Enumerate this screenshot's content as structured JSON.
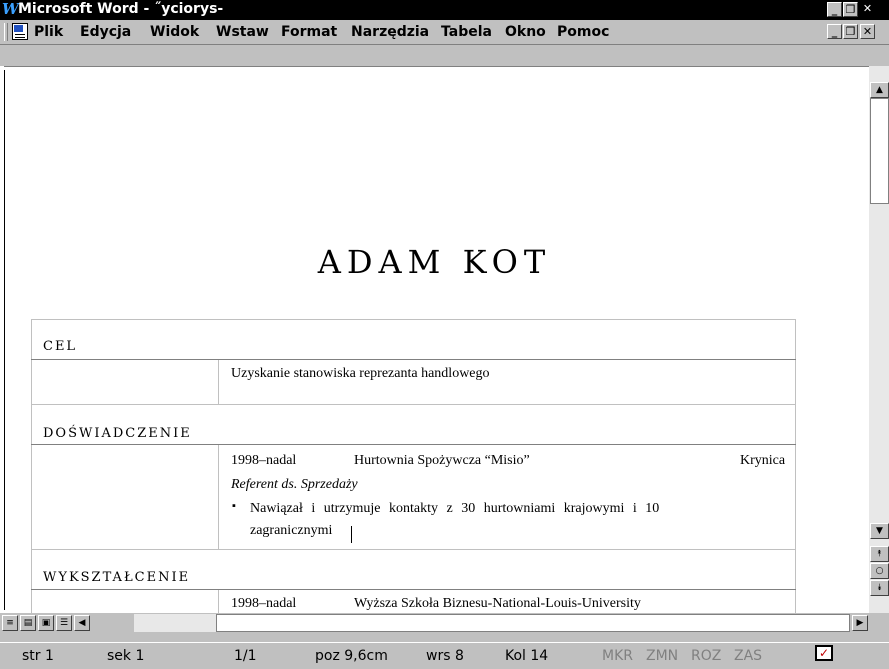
{
  "window": {
    "title": "Microsoft Word - ˝yciorys-",
    "app_icon": "word-w-icon"
  },
  "menu": {
    "items": [
      {
        "label": "Plik"
      },
      {
        "label": "Edycja"
      },
      {
        "label": "Widok"
      },
      {
        "label": "Wstaw"
      },
      {
        "label": "Format"
      },
      {
        "label": "Narzędzia"
      },
      {
        "label": "Tabela"
      },
      {
        "label": "Okno"
      },
      {
        "label": "Pomoc"
      }
    ]
  },
  "document": {
    "name": "ADAM KOT",
    "sections": [
      {
        "heading": "CEL",
        "body": "Uzyskanie stanowiska reprezanta handlowego"
      },
      {
        "heading": "DOŚWIADCZENIE",
        "date": "1998–nadal",
        "employer": "Hurtownia Spożywcza “Misio”",
        "city": "Krynica",
        "role": "Referent ds. Sprzedaży",
        "bullet_line1": "Nawiązał i utrzymuje kontakty z 30 hurtowniami krajowymi i 10",
        "bullet_line2": "zagranicznymi"
      },
      {
        "heading": "WYKSZTAŁCENIE",
        "date": "1998–nadal",
        "school": "Wyższa Szkoła Biznesu-National-Louis-University"
      }
    ]
  },
  "statusbar": {
    "page": "str 1",
    "section": "sek 1",
    "pages": "1/1",
    "position": "poz 9,6cm",
    "line": "wrs 8",
    "column": "Kol 14",
    "mkr": "MKR",
    "zmn": "ZMN",
    "roz": "ROZ",
    "zas": "ZAS",
    "spell_icon": "spelling-check-icon"
  }
}
